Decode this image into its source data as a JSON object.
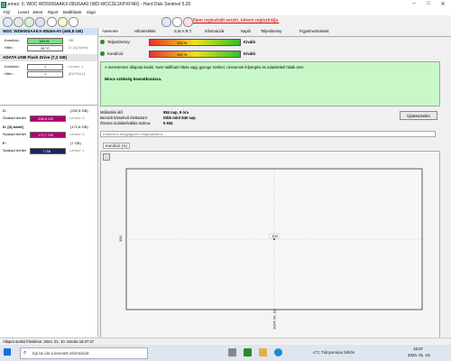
{
  "window": {
    "title": "Lemez: 0, WDC WD5000AAKX-08U6AA0 (WD-WCC2E1KPXFNR) - Hard Disk Sentinel 5.20",
    "controls": [
      "–",
      "□",
      "✕"
    ]
  },
  "menu": [
    "Fájl",
    "Lemez",
    "Jelent",
    "Riport",
    "Beállítások",
    "Súgó"
  ],
  "toolbar": {
    "registration_text": "Nem regisztrált verzió, kérem regisztrálja.",
    "icons": [
      "refresh-icon",
      "disk-icon",
      "gear-icon",
      "monitor-icon",
      "report-icon",
      "mail-icon",
      "help-icon",
      "info-icon",
      "register-icon"
    ]
  },
  "drives": [
    {
      "name": "WDC WD5000AAKX-08U6AA0",
      "size": "(465,8 GB)",
      "health_label": "Kondíció:",
      "health_value": "100 %",
      "health_fraction": 1.0,
      "health_status": "OK",
      "temp_label": "Hőm.:",
      "temp_value": "26 °C",
      "disk_label": "D: [Új kötet]"
    },
    {
      "name": "ADATA  USB Flash Drive",
      "size": "(7,2 GB)",
      "health_label": "Kondíció:",
      "health_value": "?",
      "health_status": "Lemez: 1",
      "temp_label": "Hőm.:",
      "temp_value": "?",
      "disk_label": "[INSTALL]"
    }
  ],
  "volumes": [
    {
      "letter": "C:",
      "size": "(292,5 GB)",
      "free_label": "Szabad terület",
      "free_value": "296,6 GB",
      "bar_color": "#b00070",
      "free_fraction": 1.0,
      "disk": "Lemez: 0"
    },
    {
      "letter": "D: [Új kötet]",
      "size": "(172,8 GB)",
      "free_label": "Szabad terület",
      "free_value": "172,7 GB",
      "bar_color": "#b00070",
      "free_fraction": 1.0,
      "disk": "Lemez: 0"
    },
    {
      "letter": "F:",
      "size": "(7 GB)",
      "free_label": "Szabad terület",
      "free_value": "7 GB",
      "bar_color": "#202060",
      "free_fraction": 1.0,
      "disk": "Lemez: 1"
    }
  ],
  "tabs": [
    "Áttekintés",
    "Hőmérséklet",
    "S.M.A.R.T.",
    "Információk",
    "Napló",
    "Teljesítmény",
    "Figyelmeztetések"
  ],
  "overview": {
    "performance_label": "Teljesítmény:",
    "performance_value": "100 %",
    "performance_fraction": 1.0,
    "performance_text": "Kiváló",
    "health_label": "Kondíció:",
    "health_value": "100 %",
    "health_fraction": 1.0,
    "health_text": "Kiváló",
    "message": "A merevlemez állapota kiváló. Nem található hibás vagy gyenge szektor, nincsenek felpörgési és adatátviteli hibák sem.",
    "action_text": "Nincs szükség beavatkozásra.",
    "uptime_label": "Működési idő:",
    "uptime_value": "984 nap, 9 óra",
    "est_label": "Becsült hátralévő élettartam:",
    "est_value": "több mint 840 nap",
    "starts_label": "Összes indulás/leállás száma:",
    "starts_value": "5 934",
    "recheck_button": "Újratesztelés",
    "comment_placeholder": "Kattintson megjegyzés megadásához ..."
  },
  "chart_tab": "Kondíció  (%)",
  "chart_data": {
    "type": "line",
    "x": [
      "2024. 01. 10."
    ],
    "values": [
      100
    ],
    "ylabel": "100",
    "point_label": "100",
    "xlabel": "2024. 01. 10."
  },
  "status_bar": "Állapot utolsó frissítése: 2024. 01. 10. szerda 18:37:37",
  "taskbar": {
    "search_placeholder": "Írja be ide a keresett információt.",
    "weather": "-2°C  Túlnyomóan felhős",
    "time": "18:37",
    "date": "2024. 01. 10."
  }
}
